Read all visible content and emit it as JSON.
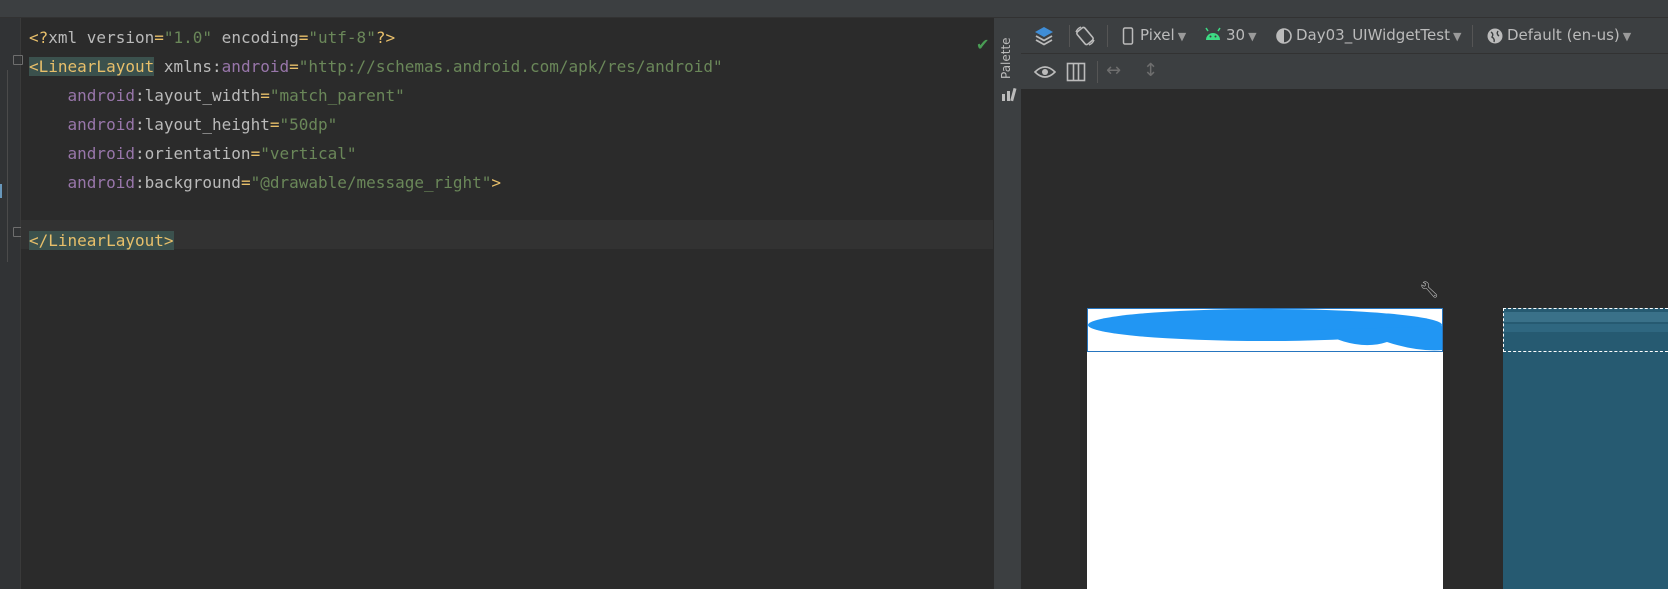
{
  "editor": {
    "lines": [
      [
        {
          "c": "c-punct",
          "t": "<?"
        },
        {
          "c": "c-attr",
          "t": "xml version"
        },
        {
          "c": "c-punct",
          "t": "="
        },
        {
          "c": "c-str",
          "t": "\"1.0\""
        },
        {
          "c": "c-attr",
          "t": " encoding"
        },
        {
          "c": "c-punct",
          "t": "="
        },
        {
          "c": "c-str",
          "t": "\"utf-8\""
        },
        {
          "c": "c-punct",
          "t": "?>"
        }
      ],
      [
        {
          "c": "c-tag c-tagbg",
          "t": "<LinearLayout"
        },
        {
          "c": "c-attr",
          "t": " xmlns:"
        },
        {
          "c": "c-ns",
          "t": "android"
        },
        {
          "c": "c-punct",
          "t": "="
        },
        {
          "c": "c-str",
          "t": "\"http://schemas.android.com/apk/res/android\""
        }
      ],
      [
        {
          "c": "c-ns",
          "t": "    android"
        },
        {
          "c": "c-attr",
          "t": ":layout_width"
        },
        {
          "c": "c-punct",
          "t": "="
        },
        {
          "c": "c-str",
          "t": "\"match_parent\""
        }
      ],
      [
        {
          "c": "c-ns",
          "t": "    android"
        },
        {
          "c": "c-attr",
          "t": ":layout_height"
        },
        {
          "c": "c-punct",
          "t": "="
        },
        {
          "c": "c-str",
          "t": "\"50dp\""
        }
      ],
      [
        {
          "c": "c-ns",
          "t": "    android"
        },
        {
          "c": "c-attr",
          "t": ":orientation"
        },
        {
          "c": "c-punct",
          "t": "="
        },
        {
          "c": "c-str",
          "t": "\"vertical\""
        }
      ],
      [
        {
          "c": "c-ns",
          "t": "    android"
        },
        {
          "c": "c-attr",
          "t": ":background"
        },
        {
          "c": "c-punct",
          "t": "="
        },
        {
          "c": "c-str",
          "t": "\"@drawable/message_right\""
        },
        {
          "c": "c-tag",
          "t": ">"
        }
      ],
      [],
      [
        {
          "c": "c-tag c-tagbg",
          "t": "</LinearLayout>"
        }
      ]
    ]
  },
  "palette": {
    "label": "Palette",
    "icon": "palette-icon"
  },
  "toolbar": {
    "device": "Pixel",
    "api_level": "30",
    "theme": "Day03_UIWidgetTest",
    "locale": "Default (en-us)",
    "icons": [
      "layers-icon",
      "orientation-icon",
      "phone-icon",
      "android-icon",
      "theme-icon",
      "globe-icon",
      "eye-icon",
      "columns-icon",
      "resize-horizontal-icon",
      "resize-vertical-icon"
    ]
  },
  "colors": {
    "bubble": "#2196f3",
    "blueprint": "#265a71",
    "selection": "#2675bf",
    "success": "#499c54"
  },
  "status": {
    "check": "✔"
  }
}
